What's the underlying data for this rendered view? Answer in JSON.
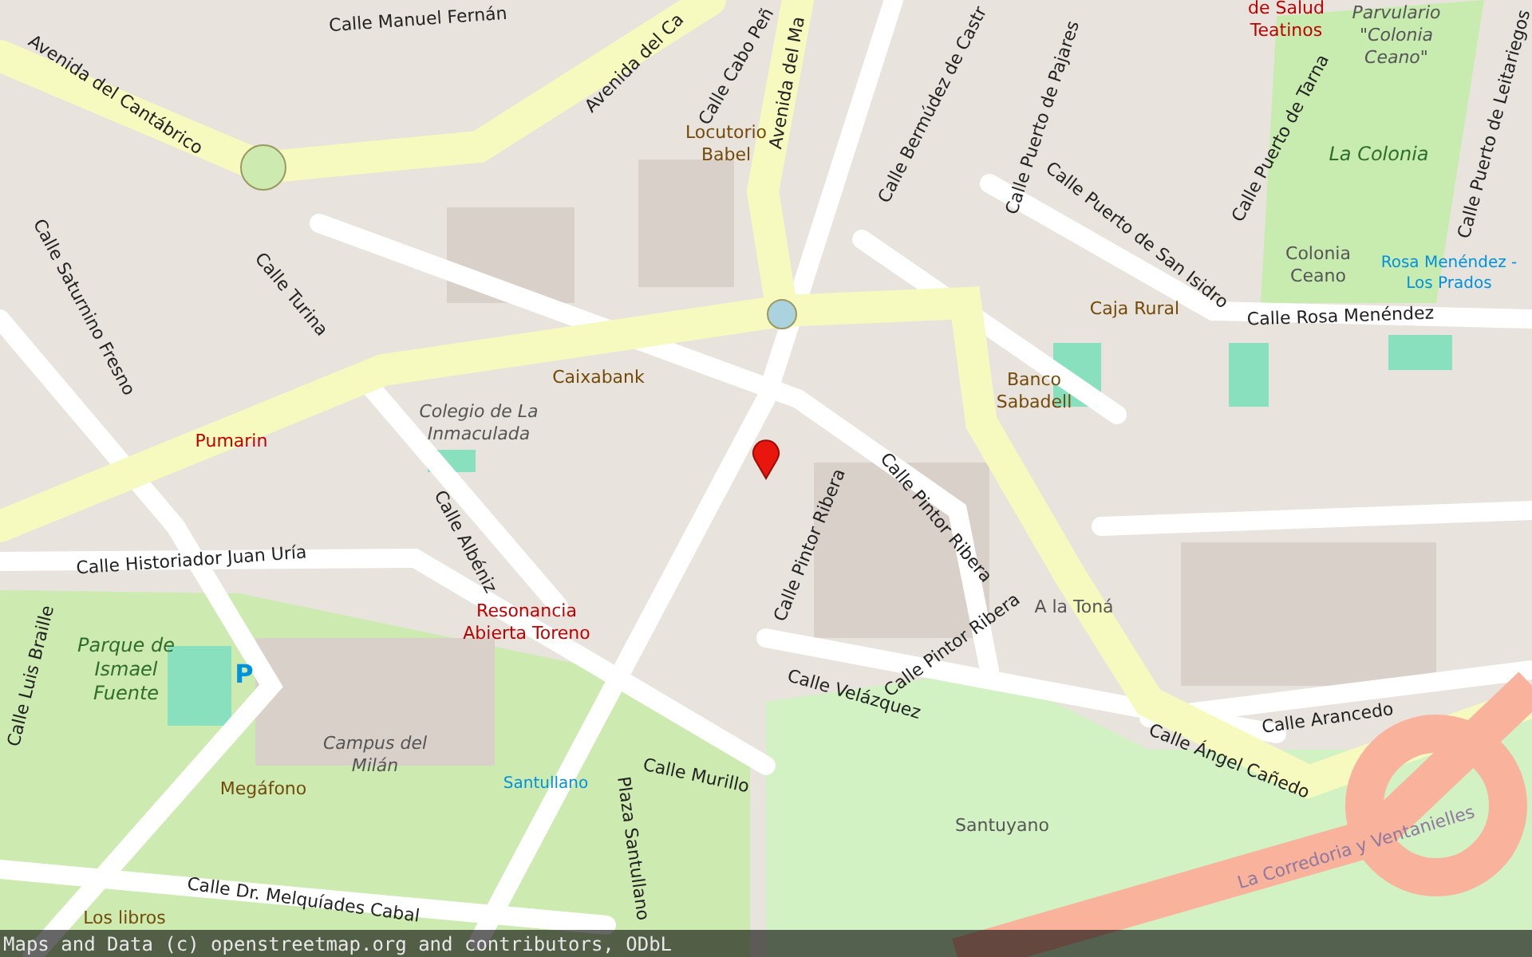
{
  "map": {
    "labels": [
      {
        "text": "Calle Manuel Fernán",
        "kind": "street"
      },
      {
        "text": "Avenida del Cantábrico",
        "kind": "street"
      },
      {
        "text": "Avenida del Ca",
        "kind": "street"
      },
      {
        "text": "Calle Cabo Peñ",
        "kind": "street"
      },
      {
        "text": "Avenida del Ma",
        "kind": "street"
      },
      {
        "text": "Calle Bermúdez de Castr",
        "kind": "street"
      },
      {
        "text": "Calle Puerto de Pajares",
        "kind": "street"
      },
      {
        "text": "Calle Puerto de San Isidro",
        "kind": "street"
      },
      {
        "text": "Calle Puerto de Tarna",
        "kind": "street"
      },
      {
        "text": "Calle Puerto de Leitariegos",
        "kind": "street"
      },
      {
        "text": "Calle Rosa Menéndez",
        "kind": "street"
      },
      {
        "text": "Calle Saturnino Fresno",
        "kind": "street"
      },
      {
        "text": "Calle Turina",
        "kind": "street"
      },
      {
        "text": "Calle Historiador Juan Uría",
        "kind": "street"
      },
      {
        "text": "Calle Luis Braille",
        "kind": "street"
      },
      {
        "text": "Calle Albéniz",
        "kind": "street"
      },
      {
        "text": "Calle Pintor Ribera",
        "kind": "street"
      },
      {
        "text": "Calle Pintor Ribera",
        "kind": "street"
      },
      {
        "text": "Calle Pintor Ribera",
        "kind": "street"
      },
      {
        "text": "Calle Velázquez",
        "kind": "street"
      },
      {
        "text": "Calle Murillo",
        "kind": "street"
      },
      {
        "text": "Plaza Santullano",
        "kind": "street"
      },
      {
        "text": "Calle Arancedo",
        "kind": "street"
      },
      {
        "text": "Calle Ángel Cañedo",
        "kind": "street"
      },
      {
        "text": "La Corredoria y Ventanielles",
        "kind": "district"
      },
      {
        "text": "Calle Dr. Melquíades Cabal",
        "kind": "street"
      },
      {
        "text": "Locutorio Babel",
        "kind": "amenity"
      },
      {
        "text": "Caixabank",
        "kind": "amenity"
      },
      {
        "text": "Colegio de La Inmaculada",
        "kind": "area"
      },
      {
        "text": "Pumarin",
        "kind": "health"
      },
      {
        "text": "Resonancia Abierta Toreno",
        "kind": "health"
      },
      {
        "text": "Banco Sabadell",
        "kind": "amenity"
      },
      {
        "text": "Caja Rural",
        "kind": "amenity"
      },
      {
        "text": "de Salud Teatinos",
        "kind": "health"
      },
      {
        "text": "Parvulario \"Colonia Ceano\"",
        "kind": "area"
      },
      {
        "text": "La Colonia",
        "kind": "park"
      },
      {
        "text": "Colonia Ceano",
        "kind": "place"
      },
      {
        "text": "Rosa Menéndez - Los Prados",
        "kind": "transit"
      },
      {
        "text": "A la Toná",
        "kind": "place"
      },
      {
        "text": "Parque de Ismael Fuente",
        "kind": "park"
      },
      {
        "text": "Campus del Milán",
        "kind": "area"
      },
      {
        "text": "Megáfono",
        "kind": "amenity"
      },
      {
        "text": "Santullano",
        "kind": "transit"
      },
      {
        "text": "Los libros",
        "kind": "amenity"
      },
      {
        "text": "Santuyano",
        "kind": "place"
      },
      {
        "text": "P",
        "kind": "parking"
      }
    ]
  },
  "attribution": "Maps and Data (c) openstreetmap.org and contributors, ODbL"
}
